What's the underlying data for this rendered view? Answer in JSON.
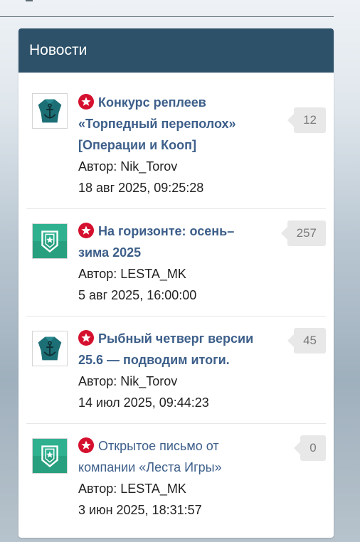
{
  "panel": {
    "title": "Новости"
  },
  "icons": {
    "pin": "star-pin-icon",
    "avatar_anchor": "anchor-shield-avatar",
    "avatar_lesta": "lesta-star-shield-avatar"
  },
  "colors": {
    "header_bg": "#2d5169",
    "title_link": "#3d5f8a",
    "pin_red": "#d5102e"
  },
  "news": [
    {
      "title_lines": [
        "Конкурс реплеев",
        "«Торпедный переполох»",
        "[Операции и Кооп]"
      ],
      "author": "Автор: Nik_Torov",
      "date": "18 авг 2025, 09:25:28",
      "count": "12",
      "avatar": "anchor"
    },
    {
      "title_lines": [
        "На горизонте: осень–",
        "зима 2025"
      ],
      "author": "Автор: LESTA_MK",
      "date": "5 авг 2025, 16:00:00",
      "count": "257",
      "avatar": "lesta"
    },
    {
      "title_lines": [
        "Рыбный четверг версии",
        "25.6 — подводим итоги."
      ],
      "author": "Автор: Nik_Torov",
      "date": "14 июл 2025, 09:44:23",
      "count": "45",
      "avatar": "anchor"
    },
    {
      "title_lines": [
        "Открытое письмо от",
        "компании «Леста Игры»"
      ],
      "author": "Автор: LESTA_MK",
      "date": "3 июн 2025, 18:31:57",
      "count": "0",
      "avatar": "lesta"
    }
  ]
}
